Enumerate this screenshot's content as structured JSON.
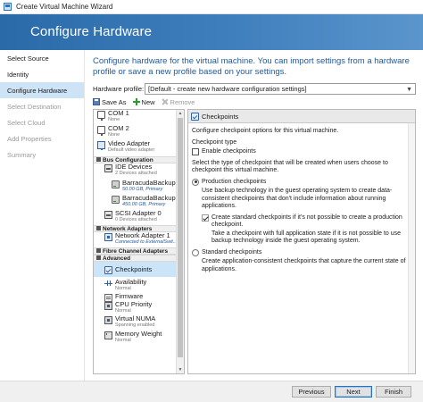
{
  "window": {
    "title": "Create Virtual Machine Wizard"
  },
  "banner": {
    "title": "Configure Hardware"
  },
  "steps": [
    {
      "label": "Select Source",
      "state": "normal"
    },
    {
      "label": "Identity",
      "state": "normal"
    },
    {
      "label": "Configure Hardware",
      "state": "active"
    },
    {
      "label": "Select Destination",
      "state": "disabled"
    },
    {
      "label": "Select Cloud",
      "state": "disabled"
    },
    {
      "label": "Add Properties",
      "state": "disabled"
    },
    {
      "label": "Summary",
      "state": "disabled"
    }
  ],
  "intro": "Configure hardware for the virtual machine. You can import settings from a hardware profile or save a new profile based on your settings.",
  "profile": {
    "label": "Hardware profile:",
    "value": "[Default - create new hardware configuration settings]"
  },
  "toolbar": {
    "save_as": "Save As",
    "new": "New",
    "remove": "Remove"
  },
  "tree": {
    "com1": {
      "name": "COM 1",
      "sub": "None"
    },
    "com2": {
      "name": "COM 2",
      "sub": "None"
    },
    "video": {
      "name": "Video Adapter",
      "sub": "Default video adapter"
    },
    "bus_section": "Bus Configuration",
    "ide": {
      "name": "IDE Devices",
      "sub": "2 Devices attached"
    },
    "disk1": {
      "name": "BarracudaBackup-...",
      "sub": "50.00 GB, Primary"
    },
    "disk2": {
      "name": "BarracudaBackup-...",
      "sub": "450.00 GB, Primary"
    },
    "scsi": {
      "name": "SCSI Adapter 0",
      "sub": "0 Devices attached"
    },
    "net_section": "Network Adapters",
    "nic": {
      "name": "Network Adapter 1",
      "sub": "Connected to ExternalSwit..."
    },
    "fc_section": "Fibre Channel Adapters",
    "adv_section": "Advanced",
    "checkpoints": {
      "name": "Checkpoints"
    },
    "availability": {
      "name": "Availability",
      "sub": "Normal"
    },
    "firmware": {
      "name": "Firmware"
    },
    "cpu_priority": {
      "name": "CPU Priority",
      "sub": "Normal"
    },
    "numa": {
      "name": "Virtual NUMA",
      "sub": "Spanning enabled"
    },
    "memory_weight": {
      "name": "Memory Weight",
      "sub": "Normal"
    }
  },
  "details": {
    "header": "Checkpoints",
    "intro": "Configure checkpoint options for this virtual machine.",
    "type_label": "Checkpoint type",
    "enable_label": "Enable checkpoints",
    "enable_checked": false,
    "select_desc": "Select the type of checkpoint that will be created when users choose to checkpoint this virtual machine.",
    "production_label": "Production checkpoints",
    "production_selected": true,
    "production_desc": "Use backup technology in the guest operating system to create data-consistent checkpoints that don't include information about running applications.",
    "fallback_label": "Create standard checkpoints if it's not possible to create a production checkpoint.",
    "fallback_checked": true,
    "fallback_desc": "Take a checkpoint with full application state if it is not possible to use backup technology inside the guest operating system.",
    "standard_label": "Standard checkpoints",
    "standard_selected": false,
    "standard_desc": "Create application-consistent checkpoints that capture the current state of applications."
  },
  "footer": {
    "previous": "Previous",
    "next": "Next",
    "finish": "Finish"
  },
  "colors": {
    "banner": "#2a6aa8",
    "accent_text": "#1f5aa0",
    "selected_bg": "#cde4f7"
  }
}
